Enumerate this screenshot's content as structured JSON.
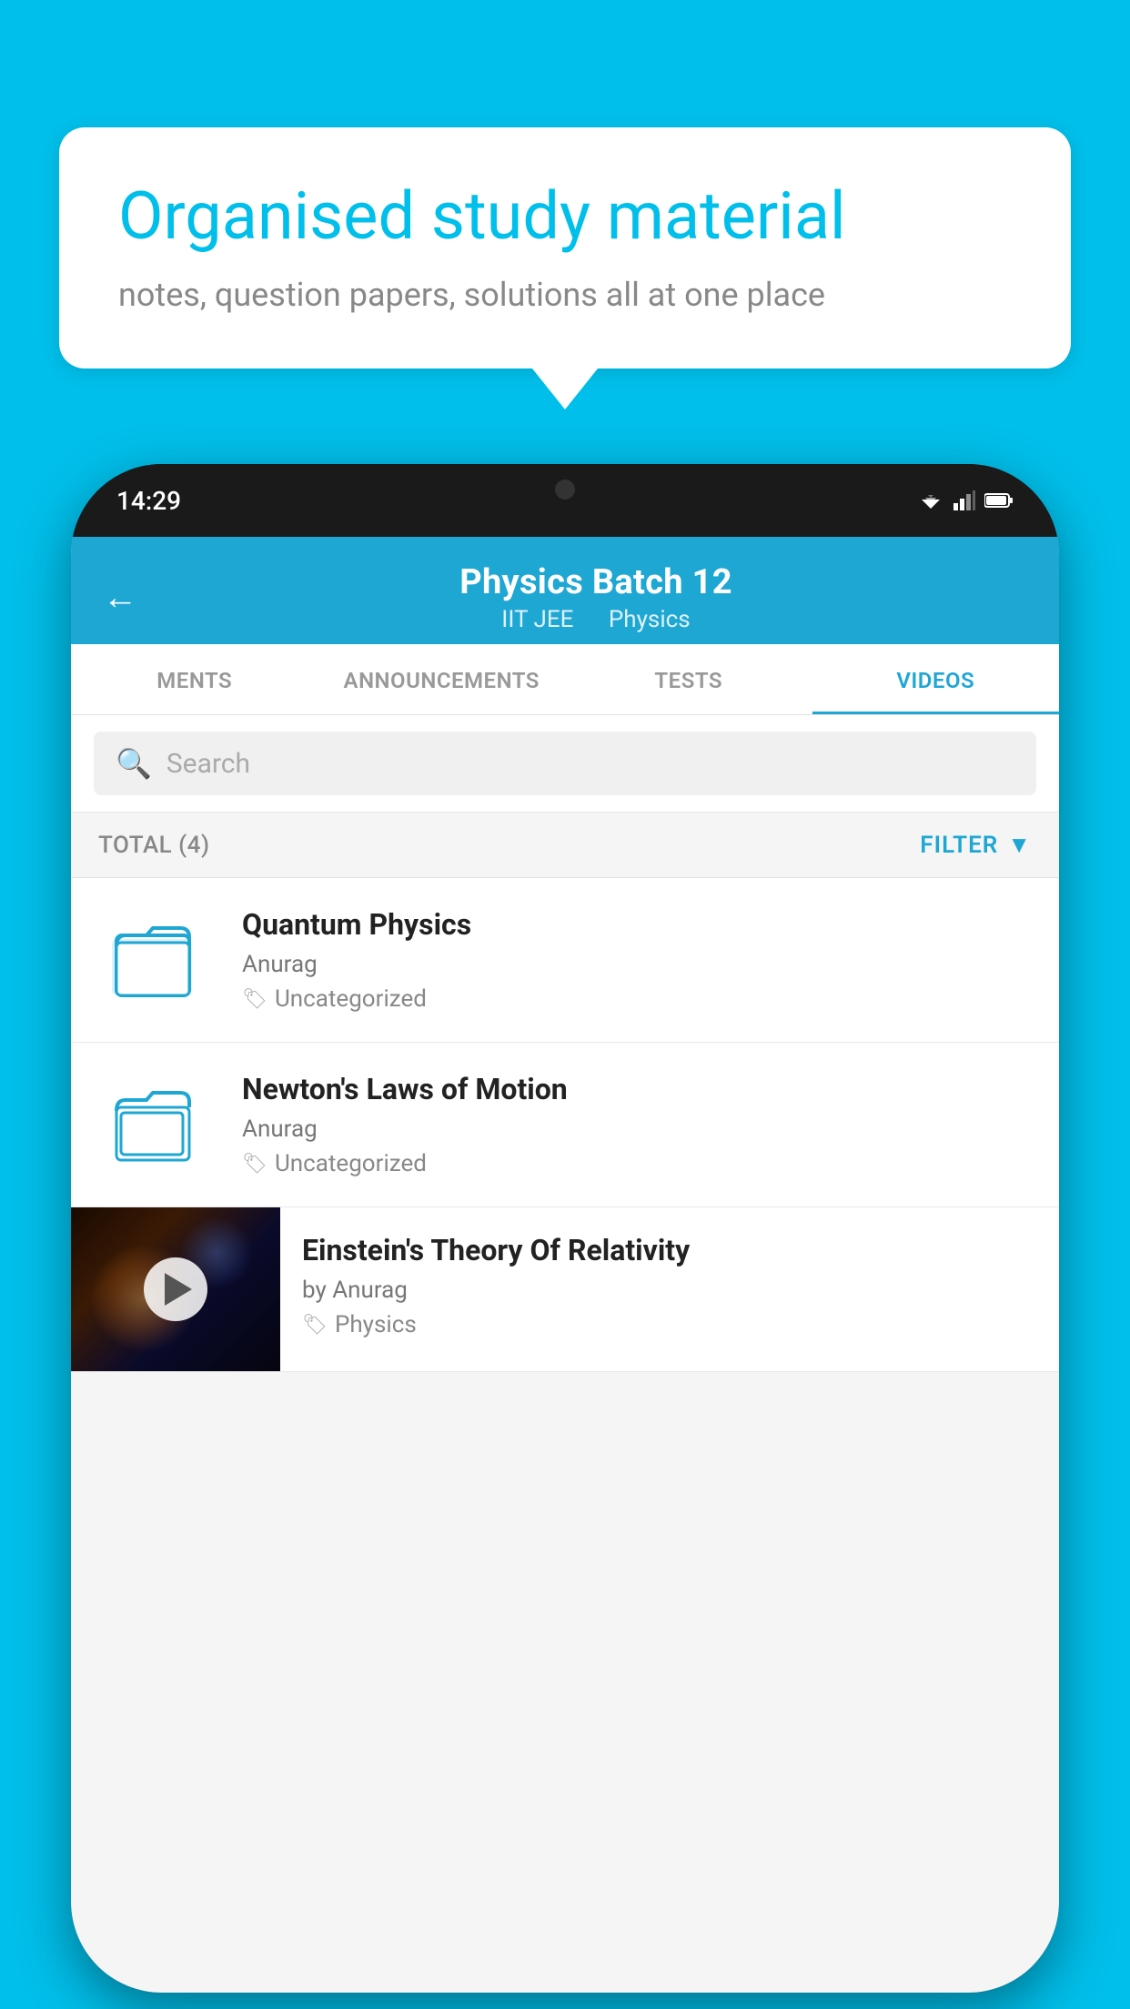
{
  "background_color": "#00BFEA",
  "speech_bubble": {
    "title": "Organised study material",
    "subtitle": "notes, question papers, solutions all at one place"
  },
  "phone": {
    "time": "14:29",
    "header": {
      "title": "Physics Batch 12",
      "subtitle_left": "IIT JEE",
      "subtitle_right": "Physics",
      "back_label": "←"
    },
    "tabs": [
      {
        "label": "MENTS",
        "active": false
      },
      {
        "label": "ANNOUNCEMENTS",
        "active": false
      },
      {
        "label": "TESTS",
        "active": false
      },
      {
        "label": "VIDEOS",
        "active": true
      }
    ],
    "search": {
      "placeholder": "Search"
    },
    "filter_bar": {
      "total_label": "TOTAL (4)",
      "filter_label": "FILTER"
    },
    "videos": [
      {
        "title": "Quantum Physics",
        "author": "Anurag",
        "tag": "Uncategorized",
        "type": "folder"
      },
      {
        "title": "Newton's Laws of Motion",
        "author": "Anurag",
        "tag": "Uncategorized",
        "type": "folder"
      },
      {
        "title": "Einstein's Theory Of Relativity",
        "author": "by Anurag",
        "tag": "Physics",
        "type": "video"
      }
    ]
  }
}
